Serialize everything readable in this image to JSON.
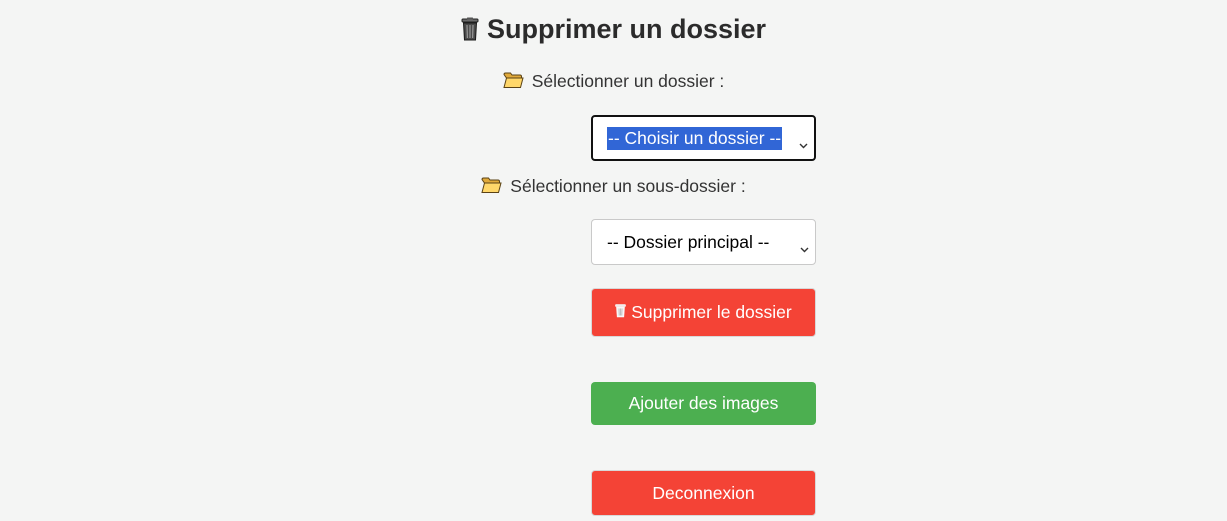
{
  "page": {
    "title": "Supprimer un dossier",
    "title_icon": "trash-can-icon"
  },
  "folder_select": {
    "label": "Sélectionner un dossier :",
    "label_icon": "folder-icon",
    "selected": "-- Choisir un dossier --"
  },
  "subfolder_select": {
    "label": "Sélectionner un sous-dossier :",
    "label_icon": "folder-icon",
    "selected": "-- Dossier principal --"
  },
  "buttons": {
    "delete_label": "Supprimer le dossier",
    "delete_icon": "trash-can-icon",
    "add_images_label": "Ajouter des images",
    "logout_label": "Deconnexion"
  },
  "colors": {
    "background": "#f4f5f4",
    "danger": "#f44336",
    "success": "#4caf50",
    "selection_highlight": "#3166d6"
  }
}
